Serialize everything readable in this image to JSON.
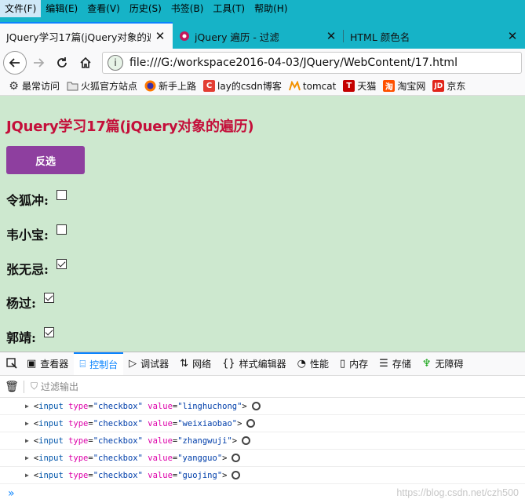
{
  "menubar": {
    "items": [
      "文件(F)",
      "编辑(E)",
      "查看(V)",
      "历史(S)",
      "书签(B)",
      "工具(T)",
      "帮助(H)"
    ]
  },
  "tabs": [
    {
      "label": "JQuery学习17篇(jQuery对象的遍",
      "active": true
    },
    {
      "label": "jQuery 遍历 - 过滤",
      "active": false
    },
    {
      "label": "HTML 颜色名",
      "active": false
    }
  ],
  "navbar": {
    "url": "file:///G:/workspace2016-04-03/JQuery/WebContent/17.html"
  },
  "bookmarks": [
    {
      "label": "最常访问",
      "icon": "gear-icon"
    },
    {
      "label": "火狐官方站点",
      "icon": "folder-icon"
    },
    {
      "label": "新手上路",
      "icon": "firefox-icon"
    },
    {
      "label": "lay的csdn博客",
      "icon": "csdn-icon"
    },
    {
      "label": "tomcat",
      "icon": "tomcat-icon"
    },
    {
      "label": "天猫",
      "icon": "tmall-icon"
    },
    {
      "label": "淘宝网",
      "icon": "taobao-icon"
    },
    {
      "label": "京东",
      "icon": "jd-icon"
    }
  ],
  "page": {
    "title": "JQuery学习17篇(jQuery对象的遍历)",
    "invert_button": "反选",
    "people": [
      {
        "name": "令狐冲:",
        "checked": false
      },
      {
        "name": "韦小宝:",
        "checked": false
      },
      {
        "name": "张无忌:",
        "checked": true
      },
      {
        "name": "杨过:",
        "checked": true
      },
      {
        "name": "郭靖:",
        "checked": true
      }
    ]
  },
  "devtools": {
    "tabs": [
      "查看器",
      "控制台",
      "调试器",
      "网络",
      "样式编辑器",
      "性能",
      "内存",
      "存储",
      "无障碍"
    ],
    "active_tab": "控制台",
    "filter_placeholder": "过滤输出",
    "log": [
      {
        "tag": "input",
        "type_attr": "type",
        "type_val": "checkbox",
        "value_attr": "value",
        "value_val": "linghuchong"
      },
      {
        "tag": "input",
        "type_attr": "type",
        "type_val": "checkbox",
        "value_attr": "value",
        "value_val": "weixiaobao"
      },
      {
        "tag": "input",
        "type_attr": "type",
        "type_val": "checkbox",
        "value_attr": "value",
        "value_val": "zhangwuji"
      },
      {
        "tag": "input",
        "type_attr": "type",
        "type_val": "checkbox",
        "value_attr": "value",
        "value_val": "yangguo"
      },
      {
        "tag": "input",
        "type_attr": "type",
        "type_val": "checkbox",
        "value_attr": "value",
        "value_val": "guojing"
      }
    ],
    "prompt": "»"
  },
  "watermark": "https://blog.csdn.net/czh500",
  "colors": {
    "menubar_bg": "#16b3c7",
    "page_bg": "#cde8cf",
    "title": "#c40f3a",
    "button": "#8e3f9f",
    "devtools_accent": "#0a84ff"
  }
}
